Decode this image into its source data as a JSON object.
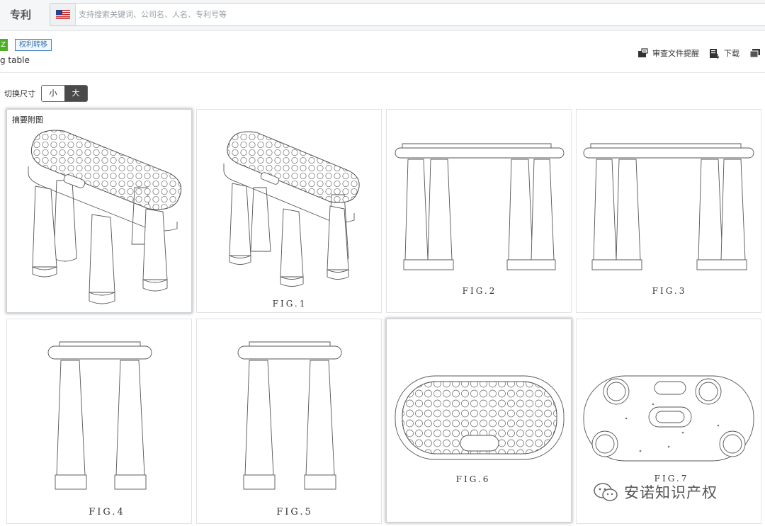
{
  "header": {
    "brand": "专利",
    "search": {
      "placeholder": "支持搜索关键词、公司名、人名、专利号等",
      "value": ""
    }
  },
  "info": {
    "status_badge": "Z",
    "tag": "权利转移",
    "title_fragment": "g table",
    "actions": [
      {
        "label": "审查文件提醒",
        "icon": "review-doc-icon"
      },
      {
        "label": "下载",
        "icon": "download-icon"
      },
      {
        "label": "",
        "icon": "folder-icon"
      }
    ]
  },
  "size_toggle": {
    "label": "切换尺寸",
    "options": [
      "小",
      "大"
    ],
    "selected": "大"
  },
  "figures": [
    {
      "caption": "摘要附图",
      "fig_label": ""
    },
    {
      "caption": "",
      "fig_label": "FIG.1"
    },
    {
      "caption": "",
      "fig_label": "FIG.2"
    },
    {
      "caption": "",
      "fig_label": "FIG.3"
    },
    {
      "caption": "",
      "fig_label": "FIG.4"
    },
    {
      "caption": "",
      "fig_label": "FIG.5"
    },
    {
      "caption": "",
      "fig_label": "FIG.6"
    },
    {
      "caption": "",
      "fig_label": "FIG.7"
    }
  ],
  "watermark": {
    "text": "安诺知识产权",
    "icon": "wechat-icon"
  },
  "colors": {
    "accent_green": "#4caf26",
    "tag_blue": "#2f6fae",
    "line": "#555555"
  }
}
